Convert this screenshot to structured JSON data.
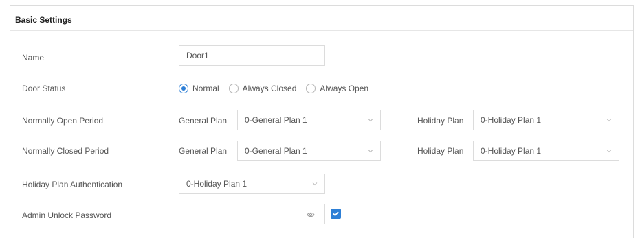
{
  "section": {
    "title": "Basic Settings"
  },
  "fields": {
    "name": {
      "label": "Name",
      "value": "Door1"
    },
    "door_status": {
      "label": "Door Status",
      "options": [
        "Normal",
        "Always Closed",
        "Always Open"
      ],
      "selected": "Normal"
    },
    "normally_open": {
      "label": "Normally Open Period",
      "general_label": "General Plan",
      "general_value": "0-General Plan 1",
      "holiday_label": "Holiday Plan",
      "holiday_value": "0-Holiday Plan 1"
    },
    "normally_closed": {
      "label": "Normally Closed Period",
      "general_label": "General Plan",
      "general_value": "0-General Plan 1",
      "holiday_label": "Holiday Plan",
      "holiday_value": "0-Holiday Plan 1"
    },
    "holiday_auth": {
      "label": "Holiday Plan Authentication",
      "value": "0-Holiday Plan 1"
    },
    "admin_password": {
      "label": "Admin Unlock Password",
      "value": "",
      "enabled": true
    }
  },
  "icons": {
    "chevron": "chevron-down-icon",
    "eye": "eye-icon",
    "check": "checkmark-icon"
  },
  "colors": {
    "accent": "#2d7fd6",
    "border": "#dcdcdc",
    "text": "#555555"
  }
}
